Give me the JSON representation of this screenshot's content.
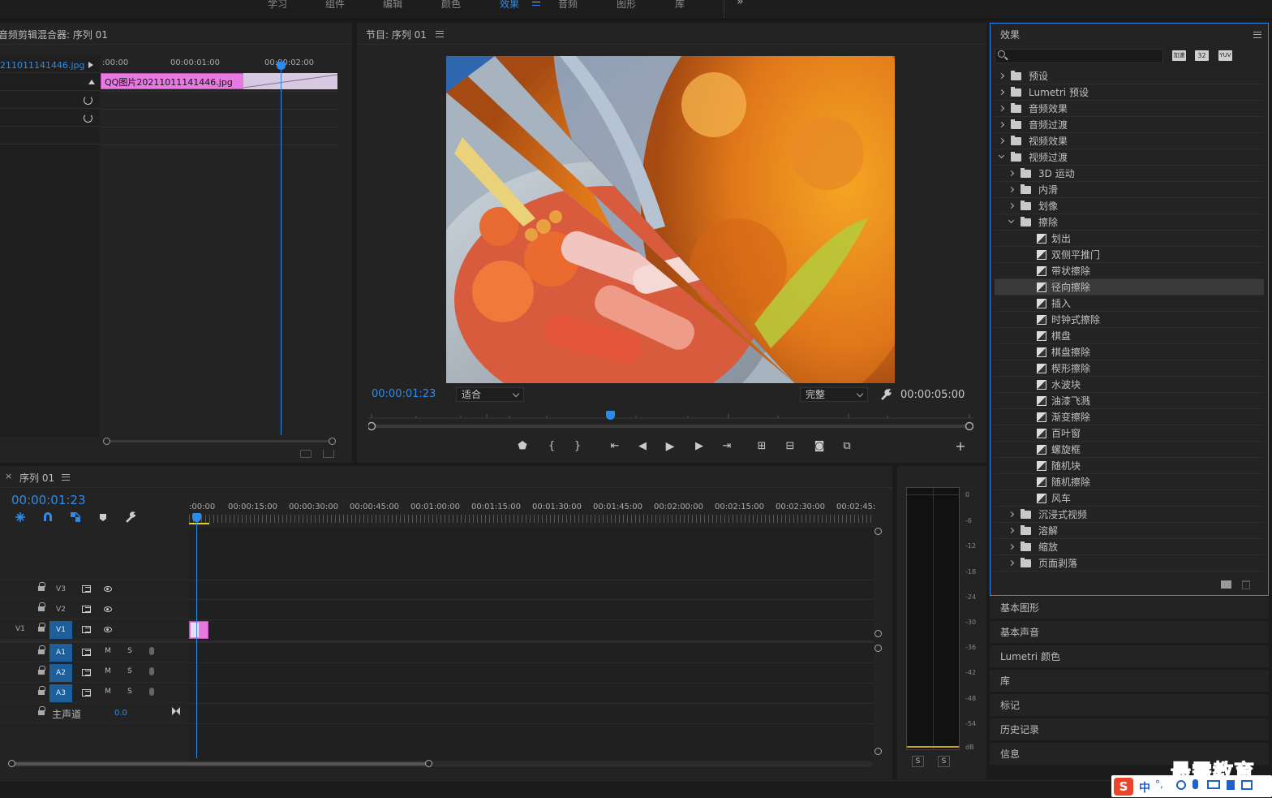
{
  "workspaces": {
    "items": [
      {
        "label": "学习"
      },
      {
        "label": "组件"
      },
      {
        "label": "编辑"
      },
      {
        "label": "颜色"
      },
      {
        "label": "效果"
      },
      {
        "label": "音频"
      },
      {
        "label": "图形"
      },
      {
        "label": "库"
      }
    ],
    "more": "»"
  },
  "mixer": {
    "title": "音频剪辑混合器: 序列 01",
    "clip_name": "211011141446.jpg",
    "ruler": [
      ":00:00",
      "00:00:01:00",
      "00:00:02:00"
    ],
    "clip_label": "QQ图片20211011141446.jpg"
  },
  "program": {
    "title": "节目: 序列 01",
    "current_time": "00:00:01:23",
    "fit": "适合",
    "quality": "完整",
    "duration": "00:00:05:00",
    "playhead_fraction": 0.4
  },
  "effects": {
    "title": "效果",
    "search_placeholder": "",
    "filter_icons": [
      "加速",
      "32",
      "YUV"
    ],
    "tree": [
      {
        "label": "预设",
        "level": 0,
        "kind": "preset",
        "open": false
      },
      {
        "label": "Lumetri 预设",
        "level": 0,
        "kind": "preset",
        "open": false
      },
      {
        "label": "音频效果",
        "level": 0,
        "kind": "folder",
        "open": false
      },
      {
        "label": "音频过渡",
        "level": 0,
        "kind": "folder",
        "open": false
      },
      {
        "label": "视频效果",
        "level": 0,
        "kind": "folder",
        "open": false
      },
      {
        "label": "视频过渡",
        "level": 0,
        "kind": "folder",
        "open": true
      },
      {
        "label": "3D 运动",
        "level": 1,
        "kind": "folder",
        "open": false
      },
      {
        "label": "内滑",
        "level": 1,
        "kind": "folder",
        "open": false
      },
      {
        "label": "划像",
        "level": 1,
        "kind": "folder",
        "open": false
      },
      {
        "label": "擦除",
        "level": 1,
        "kind": "folder",
        "open": true
      },
      {
        "label": "划出",
        "level": 2,
        "kind": "fx"
      },
      {
        "label": "双侧平推门",
        "level": 2,
        "kind": "fx"
      },
      {
        "label": "带状擦除",
        "level": 2,
        "kind": "fx"
      },
      {
        "label": "径向擦除",
        "level": 2,
        "kind": "fx",
        "selected": true
      },
      {
        "label": "插入",
        "level": 2,
        "kind": "fx"
      },
      {
        "label": "时钟式擦除",
        "level": 2,
        "kind": "fx"
      },
      {
        "label": "棋盘",
        "level": 2,
        "kind": "fx"
      },
      {
        "label": "棋盘擦除",
        "level": 2,
        "kind": "fx"
      },
      {
        "label": "楔形擦除",
        "level": 2,
        "kind": "fx"
      },
      {
        "label": "水波块",
        "level": 2,
        "kind": "fx"
      },
      {
        "label": "油漆飞溅",
        "level": 2,
        "kind": "fx"
      },
      {
        "label": "渐变擦除",
        "level": 2,
        "kind": "fx"
      },
      {
        "label": "百叶窗",
        "level": 2,
        "kind": "fx"
      },
      {
        "label": "螺旋框",
        "level": 2,
        "kind": "fx"
      },
      {
        "label": "随机块",
        "level": 2,
        "kind": "fx"
      },
      {
        "label": "随机擦除",
        "level": 2,
        "kind": "fx"
      },
      {
        "label": "风车",
        "level": 2,
        "kind": "fx"
      },
      {
        "label": "沉浸式视频",
        "level": 1,
        "kind": "folder",
        "open": false
      },
      {
        "label": "溶解",
        "level": 1,
        "kind": "folder",
        "open": false
      },
      {
        "label": "缩放",
        "level": 1,
        "kind": "folder",
        "open": false
      },
      {
        "label": "页面剥落",
        "level": 1,
        "kind": "folder",
        "open": false
      }
    ]
  },
  "side_panels": [
    {
      "label": "基本图形"
    },
    {
      "label": "基本声音"
    },
    {
      "label": "Lumetri 颜色"
    },
    {
      "label": "库"
    },
    {
      "label": "标记"
    },
    {
      "label": "历史记录"
    },
    {
      "label": "信息"
    }
  ],
  "timeline": {
    "close": "×",
    "title": "序列 01",
    "current_time": "00:00:01:23",
    "ruler": [
      ":00:00",
      "00:00:15:00",
      "00:00:30:00",
      "00:00:45:00",
      "00:01:00:00",
      "00:01:15:00",
      "00:01:30:00",
      "00:01:45:00",
      "00:02:00:00",
      "00:02:15:00",
      "00:02:30:00",
      "00:02:45:"
    ],
    "video_tracks": [
      {
        "name": "V3",
        "source": ""
      },
      {
        "name": "V2",
        "source": ""
      },
      {
        "name": "V1",
        "source": "V1"
      }
    ],
    "audio_tracks": [
      {
        "name": "A1",
        "m": "M",
        "s": "S"
      },
      {
        "name": "A2",
        "m": "M",
        "s": "S"
      },
      {
        "name": "A3",
        "m": "M",
        "s": "S"
      }
    ],
    "master": {
      "label": "主声道",
      "value": "0.0"
    }
  },
  "meters": {
    "scale": [
      "0",
      "-6",
      "-12",
      "-18",
      "-24",
      "-30",
      "-36",
      "-42",
      "-48",
      "-54",
      "dB"
    ],
    "solo": [
      "S",
      "S"
    ]
  },
  "watermark": {
    "text": "最需教育"
  },
  "ime": {
    "label": "中"
  },
  "colors": {
    "accent": "#2d8ceb",
    "clip_pink": "#e070d8",
    "panel_bg": "#232323"
  }
}
